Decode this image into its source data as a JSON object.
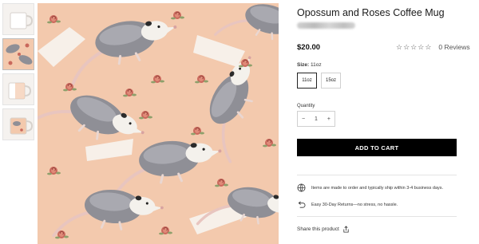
{
  "product": {
    "title": "Opossum and Roses Coffee Mug",
    "price": "$20.00",
    "rating_value": 0,
    "rating_max": 5,
    "reviews_label": "0 Reviews"
  },
  "size": {
    "label_prefix": "Size:",
    "selected": "11oz",
    "options": [
      "11oz",
      "15oz"
    ]
  },
  "quantity": {
    "label": "Quantity",
    "decrement": "−",
    "value": "1",
    "increment": "+"
  },
  "cart": {
    "add_label": "ADD TO CART"
  },
  "info": [
    {
      "icon": "globe-icon",
      "text": "Items are made to order and typically ship within 3-4 business days."
    },
    {
      "icon": "return-arrow-icon",
      "text": "Easy 30-Day Returns—no stress, no hassle."
    }
  ],
  "share": {
    "label": "Share this product",
    "icon": "share-icon"
  },
  "colors": {
    "pattern_background": "#f3c9ad",
    "opossum_fur": "#8f8f96",
    "rose": "#c9685c",
    "button": "#000000"
  }
}
